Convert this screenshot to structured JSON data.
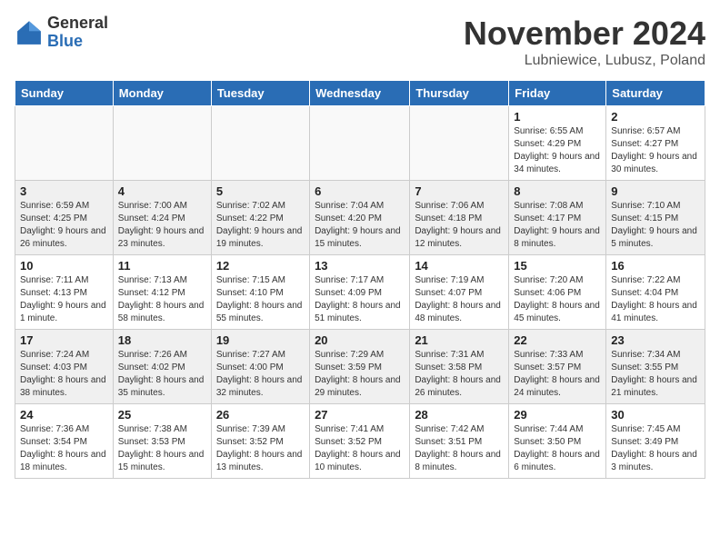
{
  "header": {
    "logo_general": "General",
    "logo_blue": "Blue",
    "month_title": "November 2024",
    "location": "Lubniewice, Lubusz, Poland"
  },
  "weekdays": [
    "Sunday",
    "Monday",
    "Tuesday",
    "Wednesday",
    "Thursday",
    "Friday",
    "Saturday"
  ],
  "weeks": [
    [
      {
        "day": "",
        "info": ""
      },
      {
        "day": "",
        "info": ""
      },
      {
        "day": "",
        "info": ""
      },
      {
        "day": "",
        "info": ""
      },
      {
        "day": "",
        "info": ""
      },
      {
        "day": "1",
        "info": "Sunrise: 6:55 AM\nSunset: 4:29 PM\nDaylight: 9 hours and 34 minutes."
      },
      {
        "day": "2",
        "info": "Sunrise: 6:57 AM\nSunset: 4:27 PM\nDaylight: 9 hours and 30 minutes."
      }
    ],
    [
      {
        "day": "3",
        "info": "Sunrise: 6:59 AM\nSunset: 4:25 PM\nDaylight: 9 hours and 26 minutes."
      },
      {
        "day": "4",
        "info": "Sunrise: 7:00 AM\nSunset: 4:24 PM\nDaylight: 9 hours and 23 minutes."
      },
      {
        "day": "5",
        "info": "Sunrise: 7:02 AM\nSunset: 4:22 PM\nDaylight: 9 hours and 19 minutes."
      },
      {
        "day": "6",
        "info": "Sunrise: 7:04 AM\nSunset: 4:20 PM\nDaylight: 9 hours and 15 minutes."
      },
      {
        "day": "7",
        "info": "Sunrise: 7:06 AM\nSunset: 4:18 PM\nDaylight: 9 hours and 12 minutes."
      },
      {
        "day": "8",
        "info": "Sunrise: 7:08 AM\nSunset: 4:17 PM\nDaylight: 9 hours and 8 minutes."
      },
      {
        "day": "9",
        "info": "Sunrise: 7:10 AM\nSunset: 4:15 PM\nDaylight: 9 hours and 5 minutes."
      }
    ],
    [
      {
        "day": "10",
        "info": "Sunrise: 7:11 AM\nSunset: 4:13 PM\nDaylight: 9 hours and 1 minute."
      },
      {
        "day": "11",
        "info": "Sunrise: 7:13 AM\nSunset: 4:12 PM\nDaylight: 8 hours and 58 minutes."
      },
      {
        "day": "12",
        "info": "Sunrise: 7:15 AM\nSunset: 4:10 PM\nDaylight: 8 hours and 55 minutes."
      },
      {
        "day": "13",
        "info": "Sunrise: 7:17 AM\nSunset: 4:09 PM\nDaylight: 8 hours and 51 minutes."
      },
      {
        "day": "14",
        "info": "Sunrise: 7:19 AM\nSunset: 4:07 PM\nDaylight: 8 hours and 48 minutes."
      },
      {
        "day": "15",
        "info": "Sunrise: 7:20 AM\nSunset: 4:06 PM\nDaylight: 8 hours and 45 minutes."
      },
      {
        "day": "16",
        "info": "Sunrise: 7:22 AM\nSunset: 4:04 PM\nDaylight: 8 hours and 41 minutes."
      }
    ],
    [
      {
        "day": "17",
        "info": "Sunrise: 7:24 AM\nSunset: 4:03 PM\nDaylight: 8 hours and 38 minutes."
      },
      {
        "day": "18",
        "info": "Sunrise: 7:26 AM\nSunset: 4:02 PM\nDaylight: 8 hours and 35 minutes."
      },
      {
        "day": "19",
        "info": "Sunrise: 7:27 AM\nSunset: 4:00 PM\nDaylight: 8 hours and 32 minutes."
      },
      {
        "day": "20",
        "info": "Sunrise: 7:29 AM\nSunset: 3:59 PM\nDaylight: 8 hours and 29 minutes."
      },
      {
        "day": "21",
        "info": "Sunrise: 7:31 AM\nSunset: 3:58 PM\nDaylight: 8 hours and 26 minutes."
      },
      {
        "day": "22",
        "info": "Sunrise: 7:33 AM\nSunset: 3:57 PM\nDaylight: 8 hours and 24 minutes."
      },
      {
        "day": "23",
        "info": "Sunrise: 7:34 AM\nSunset: 3:55 PM\nDaylight: 8 hours and 21 minutes."
      }
    ],
    [
      {
        "day": "24",
        "info": "Sunrise: 7:36 AM\nSunset: 3:54 PM\nDaylight: 8 hours and 18 minutes."
      },
      {
        "day": "25",
        "info": "Sunrise: 7:38 AM\nSunset: 3:53 PM\nDaylight: 8 hours and 15 minutes."
      },
      {
        "day": "26",
        "info": "Sunrise: 7:39 AM\nSunset: 3:52 PM\nDaylight: 8 hours and 13 minutes."
      },
      {
        "day": "27",
        "info": "Sunrise: 7:41 AM\nSunset: 3:52 PM\nDaylight: 8 hours and 10 minutes."
      },
      {
        "day": "28",
        "info": "Sunrise: 7:42 AM\nSunset: 3:51 PM\nDaylight: 8 hours and 8 minutes."
      },
      {
        "day": "29",
        "info": "Sunrise: 7:44 AM\nSunset: 3:50 PM\nDaylight: 8 hours and 6 minutes."
      },
      {
        "day": "30",
        "info": "Sunrise: 7:45 AM\nSunset: 3:49 PM\nDaylight: 8 hours and 3 minutes."
      }
    ]
  ]
}
